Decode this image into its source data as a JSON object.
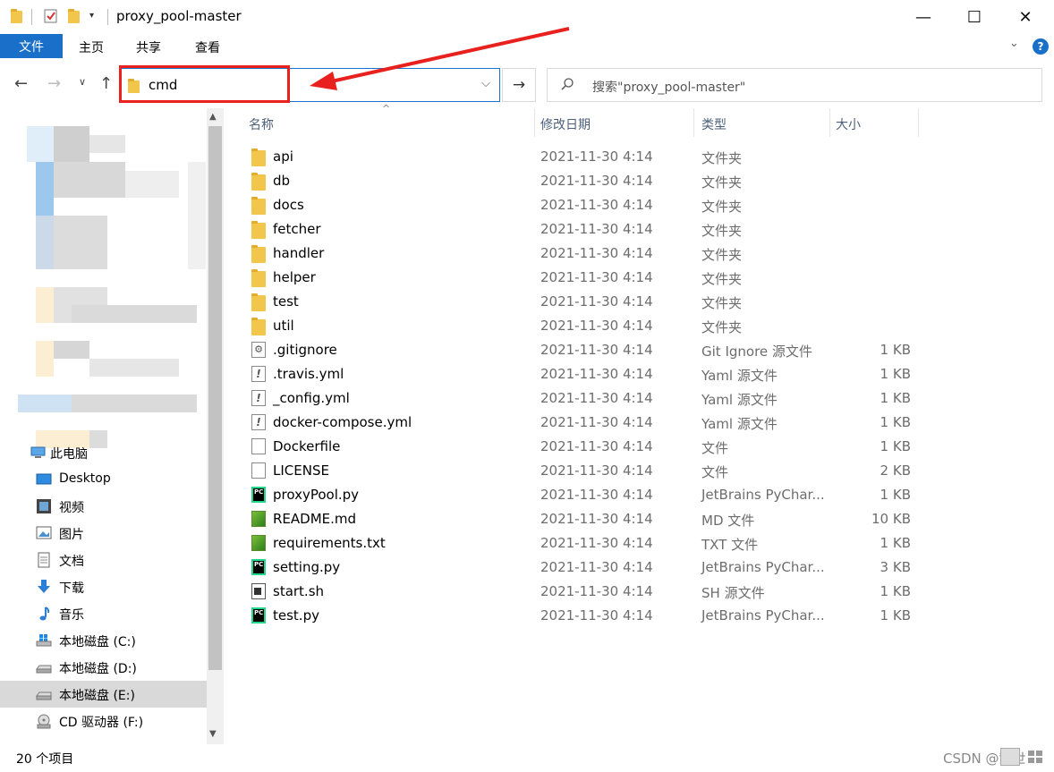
{
  "window": {
    "title": "proxy_pool-master",
    "minimize": "—",
    "maximize": "☐",
    "close": "✕"
  },
  "ribbon": {
    "tabs": [
      "文件",
      "主页",
      "共享",
      "查看"
    ],
    "help": "?"
  },
  "address": {
    "value": "cmd",
    "search_placeholder": "搜索\"proxy_pool-master\""
  },
  "columns": {
    "name": "名称",
    "date": "修改日期",
    "type": "类型",
    "size": "大小"
  },
  "files": [
    {
      "name": "api",
      "date": "2021-11-30 4:14",
      "type": "文件夹",
      "size": "",
      "icon": "folder-icon"
    },
    {
      "name": "db",
      "date": "2021-11-30 4:14",
      "type": "文件夹",
      "size": "",
      "icon": "folder-icon"
    },
    {
      "name": "docs",
      "date": "2021-11-30 4:14",
      "type": "文件夹",
      "size": "",
      "icon": "folder-icon"
    },
    {
      "name": "fetcher",
      "date": "2021-11-30 4:14",
      "type": "文件夹",
      "size": "",
      "icon": "folder-icon"
    },
    {
      "name": "handler",
      "date": "2021-11-30 4:14",
      "type": "文件夹",
      "size": "",
      "icon": "folder-icon"
    },
    {
      "name": "helper",
      "date": "2021-11-30 4:14",
      "type": "文件夹",
      "size": "",
      "icon": "folder-icon"
    },
    {
      "name": "test",
      "date": "2021-11-30 4:14",
      "type": "文件夹",
      "size": "",
      "icon": "folder-icon"
    },
    {
      "name": "util",
      "date": "2021-11-30 4:14",
      "type": "文件夹",
      "size": "",
      "icon": "folder-icon"
    },
    {
      "name": ".gitignore",
      "date": "2021-11-30 4:14",
      "type": "Git Ignore 源文件",
      "size": "1 KB",
      "icon": "gitignore-icon"
    },
    {
      "name": ".travis.yml",
      "date": "2021-11-30 4:14",
      "type": "Yaml 源文件",
      "size": "1 KB",
      "icon": "yaml-icon"
    },
    {
      "name": "_config.yml",
      "date": "2021-11-30 4:14",
      "type": "Yaml 源文件",
      "size": "1 KB",
      "icon": "yaml-icon"
    },
    {
      "name": "docker-compose.yml",
      "date": "2021-11-30 4:14",
      "type": "Yaml 源文件",
      "size": "1 KB",
      "icon": "yaml-icon"
    },
    {
      "name": "Dockerfile",
      "date": "2021-11-30 4:14",
      "type": "文件",
      "size": "1 KB",
      "icon": "file-icon"
    },
    {
      "name": "LICENSE",
      "date": "2021-11-30 4:14",
      "type": "文件",
      "size": "2 KB",
      "icon": "file-icon"
    },
    {
      "name": "proxyPool.py",
      "date": "2021-11-30 4:14",
      "type": "JetBrains PyChar...",
      "size": "1 KB",
      "icon": "pycharm-icon"
    },
    {
      "name": "README.md",
      "date": "2021-11-30 4:14",
      "type": "MD 文件",
      "size": "10 KB",
      "icon": "markdown-icon"
    },
    {
      "name": "requirements.txt",
      "date": "2021-11-30 4:14",
      "type": "TXT 文件",
      "size": "1 KB",
      "icon": "markdown-icon"
    },
    {
      "name": "setting.py",
      "date": "2021-11-30 4:14",
      "type": "JetBrains PyChar...",
      "size": "3 KB",
      "icon": "pycharm-icon"
    },
    {
      "name": "start.sh",
      "date": "2021-11-30 4:14",
      "type": "SH 源文件",
      "size": "1 KB",
      "icon": "shell-icon"
    },
    {
      "name": "test.py",
      "date": "2021-11-30 4:14",
      "type": "JetBrains PyChar...",
      "size": "1 KB",
      "icon": "pycharm-icon"
    }
  ],
  "nav": {
    "items": [
      {
        "label": "此电脑",
        "icon": "computer-icon"
      },
      {
        "label": "Desktop",
        "icon": "desktop-icon"
      },
      {
        "label": "视频",
        "icon": "video-icon"
      },
      {
        "label": "图片",
        "icon": "picture-icon"
      },
      {
        "label": "文档",
        "icon": "document-icon"
      },
      {
        "label": "下载",
        "icon": "download-icon"
      },
      {
        "label": "音乐",
        "icon": "music-icon"
      },
      {
        "label": "本地磁盘 (C:)",
        "icon": "windows-drive-icon"
      },
      {
        "label": "本地磁盘 (D:)",
        "icon": "drive-icon"
      },
      {
        "label": "本地磁盘 (E:)",
        "icon": "drive-icon"
      },
      {
        "label": "CD 驱动器 (F:)",
        "icon": "cd-drive-icon"
      }
    ]
  },
  "status": {
    "count": "20 个项目",
    "watermark": "CSDN @乱世"
  },
  "colors": {
    "accent": "#1a6fc9",
    "highlight": "#e8211e",
    "folder": "#f2c54b"
  }
}
